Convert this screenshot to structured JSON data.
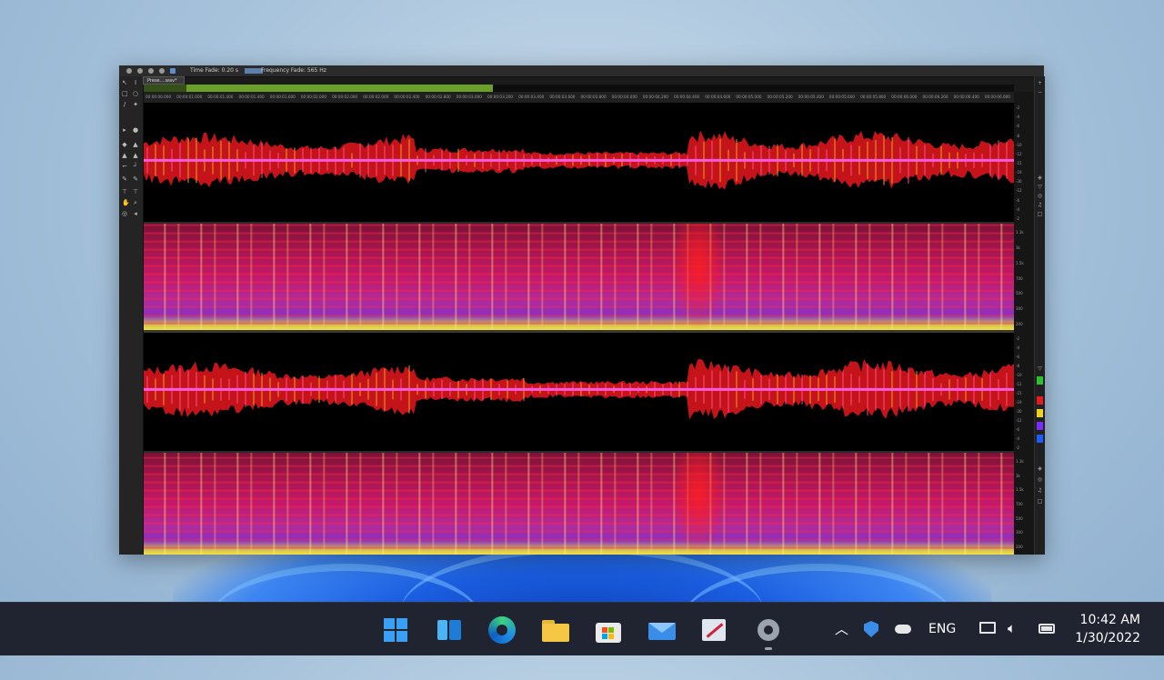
{
  "app": {
    "file_tab": "Prese....wav*",
    "time_fade_label": "Time Fade: 0.20 s",
    "frequency_fade_label": "Frequency Fade: 565 Hz"
  },
  "ruler_labels": [
    "00:00:00.000",
    "00:00:01.000",
    "00:00:01.400",
    "00:00:01.400",
    "00:00:01.600",
    "00:00:02.000",
    "00:00:02.000",
    "00:00:02.000",
    "00:00:02.400",
    "00:00:02.800",
    "00:00:03.000",
    "00:00:03.200",
    "00:00:03.400",
    "00:00:03.600",
    "00:00:03.800",
    "00:00:04.000",
    "00:00:04.200",
    "00:00:04.400",
    "00:00:04.600",
    "00:00:05.000",
    "00:00:05.200",
    "00:00:05.400",
    "00:00:05.600",
    "00:00:05.800",
    "00:00:06.000",
    "00:00:06.200",
    "00:00:06.400",
    "00:00:06.600"
  ],
  "scale_labels": {
    "wave_top": [
      "-2",
      "-4",
      "-6",
      "-8",
      "-10",
      "-12",
      "-15",
      "-19",
      "-30",
      "-12",
      "-6",
      "-4",
      "-2"
    ],
    "spec_top": [
      "1.1k",
      "3k",
      "1.5k",
      "700",
      "500",
      "300",
      "200"
    ],
    "wave_bottom": [
      "-2",
      "-4",
      "-6",
      "-8",
      "-10",
      "-12",
      "-15",
      "-19",
      "-30",
      "-12",
      "-6",
      "-4",
      "-2"
    ],
    "spec_bottom": [
      "1.1k",
      "3k",
      "1.5k",
      "700",
      "500",
      "300",
      "200"
    ]
  },
  "colors": {
    "wave": "#c4141a",
    "wave_core": "#ff5adc",
    "swatches": [
      "#2ec12e",
      "#e41c1c",
      "#f0d21a",
      "#7a2cff",
      "#1e5bff"
    ]
  },
  "taskbar": {
    "apps": [
      {
        "name": "start",
        "icon": "windows-logo-icon"
      },
      {
        "name": "widgets",
        "icon": "widgets-icon"
      },
      {
        "name": "edge",
        "icon": "edge-browser-icon"
      },
      {
        "name": "explorer",
        "icon": "folder-icon"
      },
      {
        "name": "store",
        "icon": "store-icon"
      },
      {
        "name": "mail",
        "icon": "mail-icon"
      },
      {
        "name": "app",
        "icon": "pen-app-icon"
      },
      {
        "name": "settings",
        "icon": "gear-icon"
      }
    ],
    "language": "ENG",
    "time": "10:42 AM",
    "date": "1/30/2022"
  }
}
